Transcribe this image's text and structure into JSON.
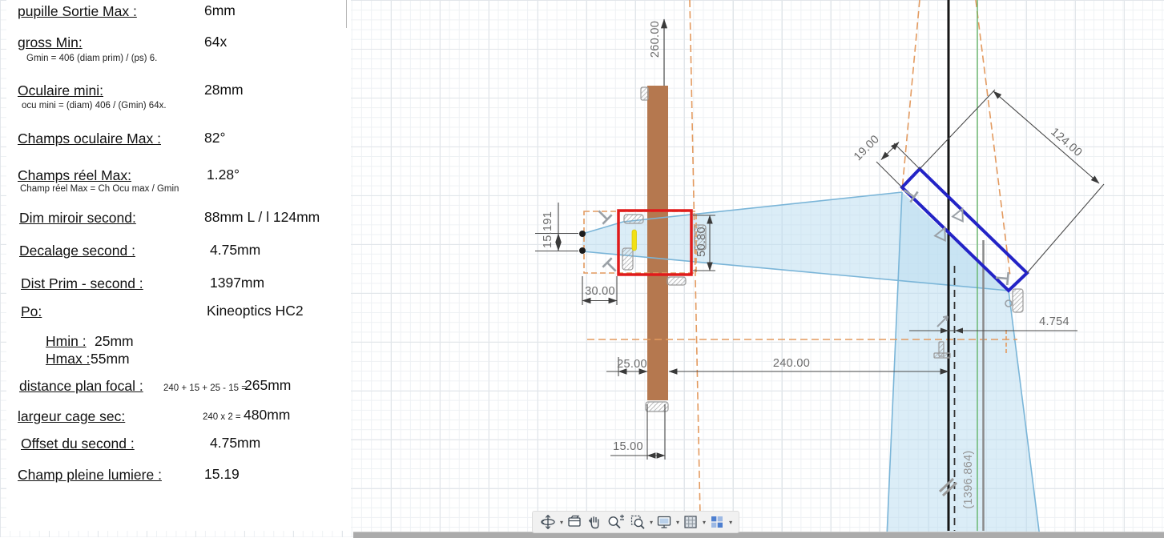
{
  "panel": {
    "rows": [
      {
        "label": "pupille Sortie Max :",
        "value": "6mm"
      },
      {
        "label": "gross Min:",
        "value": "64x",
        "sub": "Gmin = 406 (diam prim) / (ps) 6."
      },
      {
        "label": "Oculaire mini:",
        "value": "28mm",
        "sub": "ocu mini = (diam) 406 / (Gmin) 64x."
      },
      {
        "label": "Champs oculaire Max :",
        "value": "82°"
      },
      {
        "label": "Champs réel Max:",
        "value": "1.28°",
        "sub": "Champ réel Max = Ch Ocu max / Gmin"
      },
      {
        "label": "Dim miroir second:",
        "value": "88mm L / l 124mm"
      },
      {
        "label": "Decalage second :",
        "value": "4.75mm"
      },
      {
        "label": "Dist Prim - second :",
        "value": "1397mm"
      },
      {
        "label": "Po:",
        "value": "Kineoptics HC2"
      },
      {
        "label": "Hmin :",
        "value": "25mm"
      },
      {
        "label": "Hmax :",
        "value": "55mm"
      },
      {
        "label": "distance plan focal :",
        "formula": "240 + 15 + 25 - 15 =",
        "value": "265mm"
      },
      {
        "label": "largeur cage sec:",
        "formula": "240 x 2 =",
        "value": "480mm"
      },
      {
        "label": "Offset du second :",
        "value": "4.75mm"
      },
      {
        "label": "Champ  pleine lumiere :",
        "value": "15.19"
      }
    ]
  },
  "drawing": {
    "dims": {
      "v260": "260.00",
      "v15191": "15.191",
      "v30": "30.00",
      "v5080": "50.80",
      "v25": "25.00",
      "v240": "240.00",
      "v15": "15.00",
      "v19": "19.00",
      "v124": "124.00",
      "v4754": "4.754",
      "v1396": "(1396.864)"
    }
  },
  "toolbar": {
    "items": [
      {
        "name": "orbit",
        "caret": "▾"
      },
      {
        "name": "look-at"
      },
      {
        "name": "pan"
      },
      {
        "name": "zoom"
      },
      {
        "name": "window-zoom",
        "caret": "▾"
      },
      {
        "name": "display-settings",
        "caret": "▾"
      },
      {
        "name": "grid-display",
        "caret": "▾"
      },
      {
        "name": "viewports",
        "caret": "▾"
      }
    ]
  },
  "colors": {
    "accent_red": "#e01b1b",
    "mirror_blue": "#2323c6",
    "cone_blue": "#bcdcf0",
    "wood_brown": "#b5784f",
    "dashed_orange": "#e39a5f",
    "highlight_yellow": "#f2e013",
    "axis_green": "#58b158"
  }
}
